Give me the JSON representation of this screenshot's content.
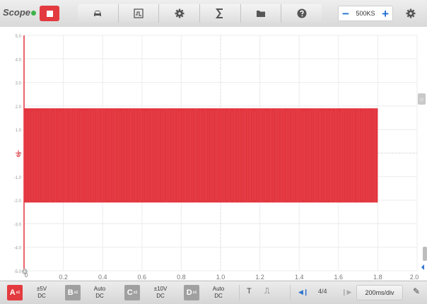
{
  "app": {
    "title": "Scope"
  },
  "toolbar": {
    "tools": [
      "vehicle-icon",
      "waveform-library-icon",
      "settings-gear-icon",
      "sigma-math-icon",
      "folder-icon",
      "help-icon"
    ],
    "sample_rate": "500KS",
    "decrease": "−",
    "increase": "+"
  },
  "plot": {
    "y_ticks": [
      "5.0",
      "4.0",
      "3.0",
      "2.0",
      "1.0",
      "0",
      "-1.0",
      "-2.0",
      "-3.0",
      "-4.0",
      "-5.0"
    ],
    "x_ticks": [
      "0.2",
      "0.4",
      "0.6",
      "0.8",
      "1.0",
      "1.2",
      "1.4",
      "1.6",
      "1.8",
      "2.0"
    ],
    "x_origin": "0",
    "channel_marker": "A",
    "trace_color": "#e2323b",
    "signal_high_v": 1.9,
    "signal_low_v": -2.1,
    "signal_end_s": 1.8
  },
  "bottombar": {
    "channels": [
      {
        "letter": "A",
        "color": "#e33a3f",
        "range": "±5V",
        "coupling": "DC"
      },
      {
        "letter": "B",
        "color": "#a0a0a0",
        "range": "Auto",
        "coupling": "DC"
      },
      {
        "letter": "C",
        "color": "#a0a0a0",
        "range": "±10V",
        "coupling": "DC"
      },
      {
        "letter": "D",
        "color": "#a0a0a0",
        "range": "Auto",
        "coupling": "DC"
      }
    ],
    "trigger_label": "T",
    "pulse_icon": "⎍",
    "page": "4/4",
    "timebase": "200ms/div"
  }
}
